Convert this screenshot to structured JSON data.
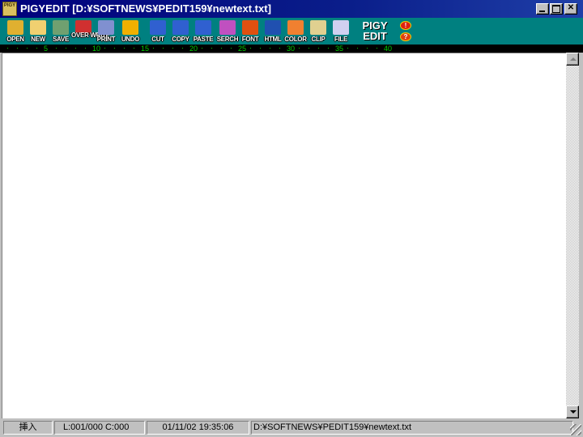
{
  "window": {
    "title": "PIGYEDIT [D:¥SOFTNEWS¥PEDIT159¥newtext.txt]",
    "app_icon_text": "PIGY",
    "close_glyph": "✕"
  },
  "toolbar": {
    "buttons": [
      {
        "label": "OPEN",
        "icon": "folder-open-icon",
        "color": "#e0b030"
      },
      {
        "label": "NEW",
        "icon": "new-file-icon",
        "color": "#f0d070"
      },
      {
        "label": "SAVE",
        "icon": "floppy-icon",
        "color": "#70a070"
      },
      {
        "label": "OVER WRITE",
        "icon": "overwrite-icon",
        "color": "#d03030"
      },
      {
        "label": "PRINT",
        "icon": "printer-icon",
        "color": "#8090d0"
      },
      {
        "label": "UNDO",
        "icon": "undo-icon",
        "color": "#f0b000"
      },
      {
        "label": "CUT",
        "icon": "cut-icon",
        "color": "#3060d0"
      },
      {
        "label": "COPY",
        "icon": "copy-icon",
        "color": "#3060d0"
      },
      {
        "label": "PASTE",
        "icon": "paste-icon",
        "color": "#3060d0"
      },
      {
        "label": "SERCH",
        "icon": "search-icon",
        "color": "#c050c0"
      },
      {
        "label": "FONT",
        "icon": "font-icon",
        "color": "#e05010"
      },
      {
        "label": "HTML",
        "icon": "globe-icon",
        "color": "#2050b0"
      },
      {
        "label": "COLOR",
        "icon": "rainbow-icon",
        "color": "#f08030"
      },
      {
        "label": "CLIP",
        "icon": "clipboard-icon",
        "color": "#e0d090"
      },
      {
        "label": "FILE",
        "icon": "file-icon",
        "color": "#d0d0f0"
      }
    ],
    "logo_line1": "PIGY",
    "logo_line2": "EDIT",
    "alert_glyph": "!",
    "help_glyph": "?"
  },
  "ruler": {
    "numbers": [
      "5",
      "10",
      "15",
      "20",
      "25",
      "30",
      "35",
      "40"
    ],
    "color": "#00d000"
  },
  "editor": {
    "content": ""
  },
  "statusbar": {
    "mode": "挿入",
    "position": "L:001/000  C:000",
    "datetime": "01/11/02 19:35:06",
    "path": "D:¥SOFTNEWS¥PEDIT159¥newtext.txt"
  }
}
